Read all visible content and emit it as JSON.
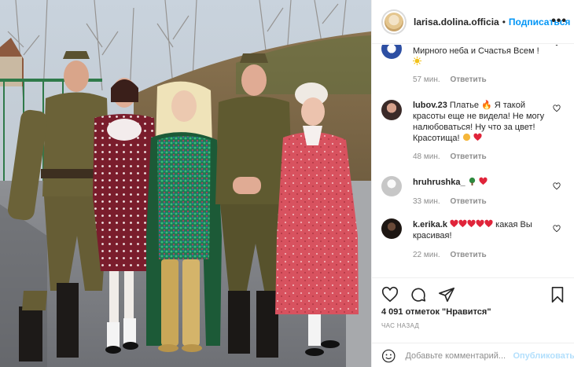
{
  "header": {
    "username": "larisa.dolina.officia",
    "separator": "•",
    "follow_label": "Подписаться",
    "more_label": "•••"
  },
  "comments": [
    {
      "text": "Мирного неба и Счастья Всем !",
      "emoji": "sun",
      "time": "57 мин.",
      "reply": "Ответить",
      "avatar_color": "#2d4fa3"
    },
    {
      "username": "lubov.23",
      "text": "Платье 🔥 Я такой красоты еще не видела! Не могу налюбоваться! Ну что за цвет! Красотища!",
      "time": "48 мин.",
      "reply": "Ответить",
      "avatar_color": "#3a2a28"
    },
    {
      "username": "hruhrushka_",
      "text": "",
      "time": "33 мин.",
      "reply": "Ответить",
      "avatar_color": "#c7c7c7"
    },
    {
      "username": "k.erika.k",
      "text": "какая Вы красивая!",
      "time": "22 мин.",
      "reply": "Ответить",
      "avatar_color": "#1d1612"
    }
  ],
  "actions": {
    "like_icon": "heart-icon",
    "comment_icon": "comment-icon",
    "share_icon": "share-icon",
    "save_icon": "bookmark-icon"
  },
  "likes_text": "4 091 отметок \"Нравится\"",
  "time_ago": "ЧАС НАЗАД",
  "add_comment": {
    "placeholder": "Добавьте комментарий...",
    "publish_label": "Опубликовать"
  },
  "colors": {
    "accent": "#0095f6",
    "publish_disabled": "#b2dffc",
    "heart_red": "#ed4956"
  }
}
